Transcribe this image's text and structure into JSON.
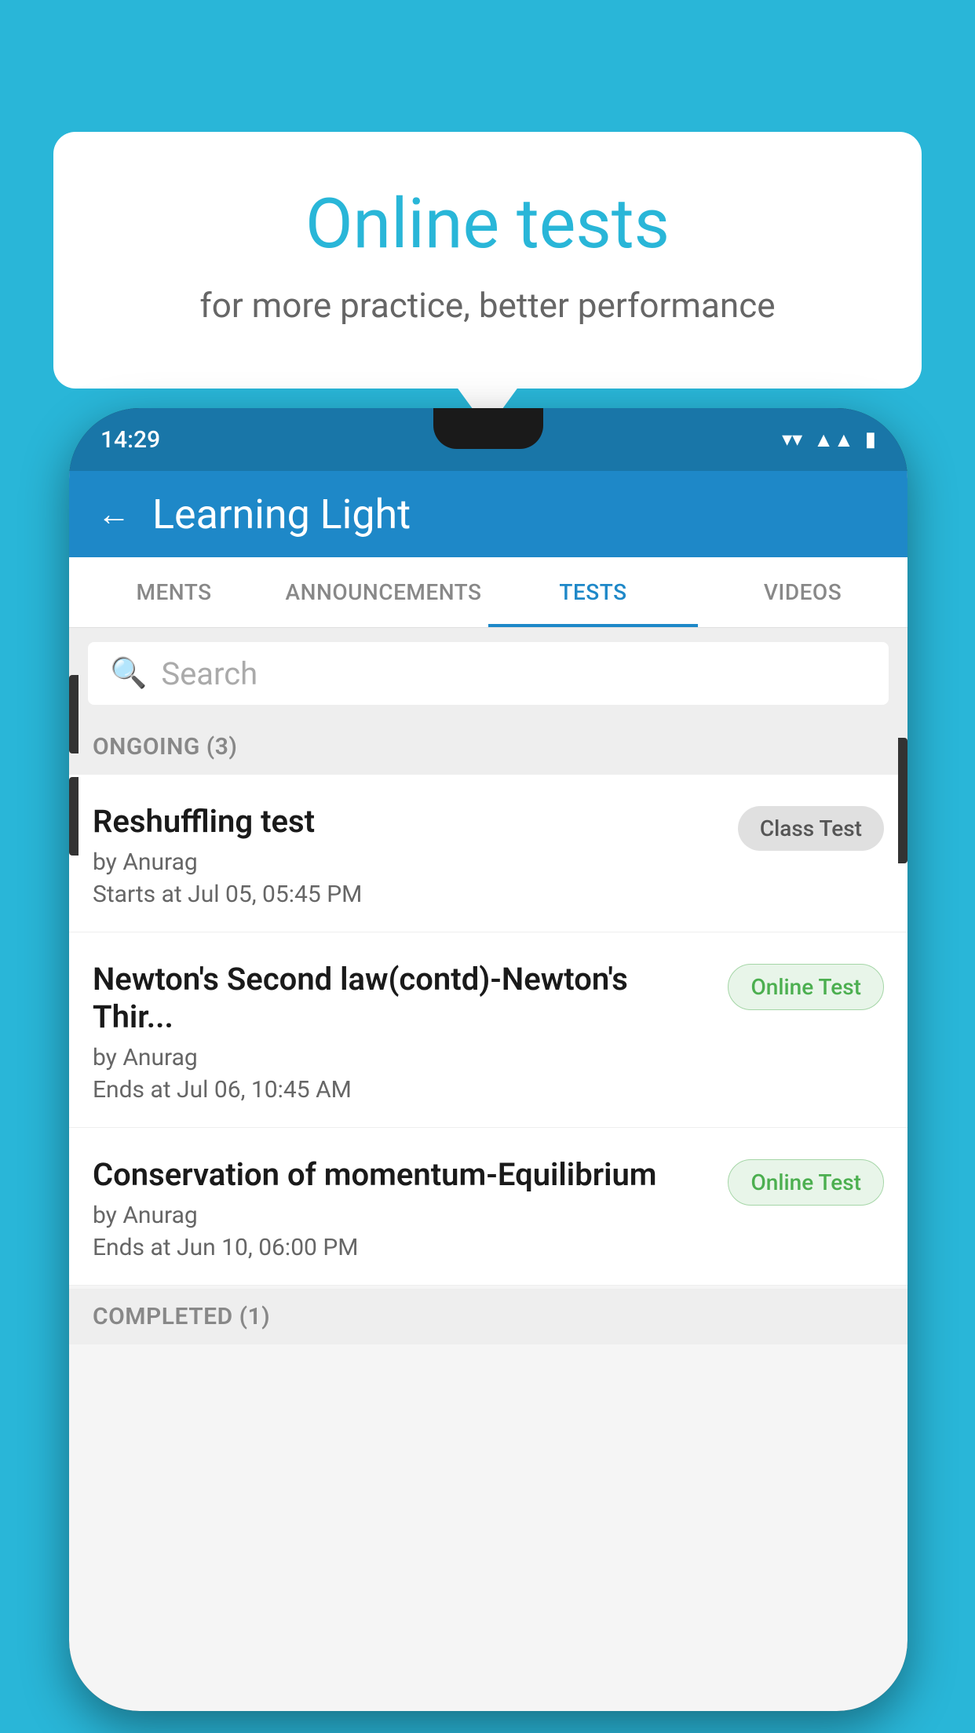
{
  "background": {
    "color": "#29b6d8"
  },
  "bubble": {
    "title": "Online tests",
    "subtitle": "for more practice, better performance"
  },
  "phone": {
    "status_bar": {
      "time": "14:29",
      "wifi_icon": "▼",
      "signal_icon": "▲",
      "battery_icon": "▮"
    },
    "header": {
      "title": "Learning Light",
      "back_label": "←"
    },
    "tabs": [
      {
        "label": "MENTS",
        "active": false
      },
      {
        "label": "ANNOUNCEMENTS",
        "active": false
      },
      {
        "label": "TESTS",
        "active": true
      },
      {
        "label": "VIDEOS",
        "active": false
      }
    ],
    "search": {
      "placeholder": "Search"
    },
    "ongoing_section": {
      "label": "ONGOING (3)"
    },
    "tests": [
      {
        "title": "Reshuffling test",
        "by": "by Anurag",
        "date": "Starts at  Jul 05, 05:45 PM",
        "badge": "Class Test",
        "badge_type": "gray"
      },
      {
        "title": "Newton's Second law(contd)-Newton's Thir...",
        "by": "by Anurag",
        "date": "Ends at  Jul 06, 10:45 AM",
        "badge": "Online Test",
        "badge_type": "green"
      },
      {
        "title": "Conservation of momentum-Equilibrium",
        "by": "by Anurag",
        "date": "Ends at  Jun 10, 06:00 PM",
        "badge": "Online Test",
        "badge_type": "green"
      }
    ],
    "completed_section": {
      "label": "COMPLETED (1)"
    }
  }
}
